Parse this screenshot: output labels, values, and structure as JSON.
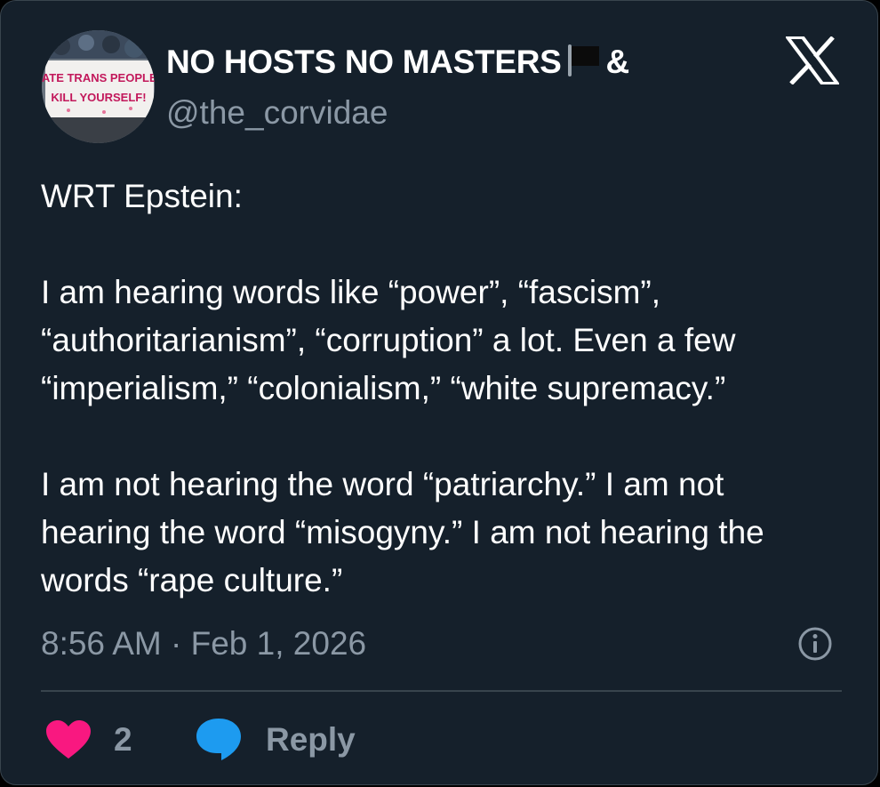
{
  "author": {
    "display_name": "NO HOSTS NO MASTERS",
    "display_name_suffix": "&",
    "handle": "@the_corvidae",
    "avatar_icon": "protest-banner-avatar",
    "avatar_text_line1": "HATE TRANS PEOPLE?",
    "avatar_text_line2": "KILL YOURSELF!"
  },
  "platform_icon": "x-logo-icon",
  "post": {
    "paragraphs": [
      "WRT Epstein:",
      "I am hearing words like “power”, “fascism”, “authoritarianism”, “corruption” a lot. Even a few “imperialism,” “colonialism,” “white supremacy.”",
      "I am not hearing the word “patriarchy.” I am not hearing the word “misogyny.” I am not hearing the words “rape culture.”"
    ],
    "timestamp": "8:56 AM · Feb 1, 2026"
  },
  "actions": {
    "like_count": "2",
    "reply_label": "Reply"
  },
  "colors": {
    "background": "#15202b",
    "secondary_text": "#8b98a5",
    "like": "#f91880",
    "reply": "#1d9bf0",
    "divider": "#38444d"
  }
}
